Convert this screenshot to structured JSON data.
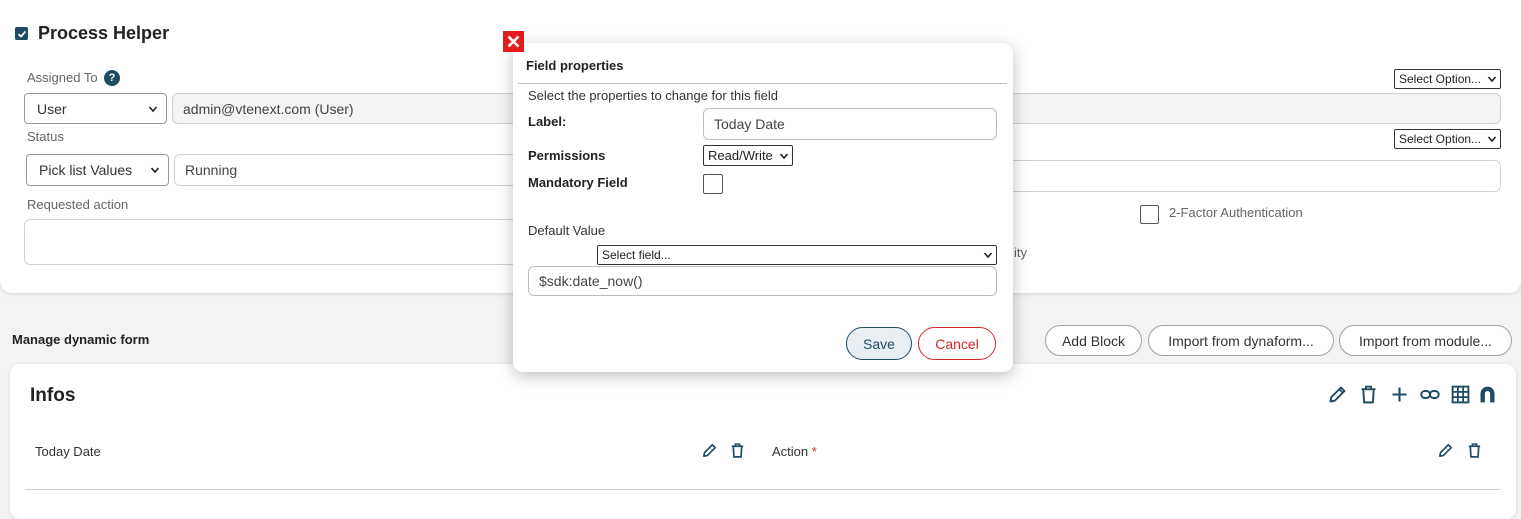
{
  "process_helper": {
    "title": "Process Helper",
    "assigned_to": {
      "label": "Assigned To",
      "help": "?",
      "type_select": "User",
      "value": "admin@vtenext.com (User)"
    },
    "status": {
      "label": "Status",
      "type_select": "Pick list Values",
      "value": "Running"
    },
    "requested_action": {
      "label": "Requested action",
      "value": ""
    },
    "right_select_1": "Select Option...",
    "right_select_2": "Select Option...",
    "partial_text": "ity",
    "two_factor_label": "2-Factor Authentication"
  },
  "dynamic_form": {
    "title": "Manage dynamic form",
    "buttons": {
      "add_block": "Add Block",
      "import_dynaform": "Import from dynaform...",
      "import_module": "Import from module..."
    }
  },
  "infos_block": {
    "title": "Infos",
    "fields": [
      {
        "label": "Today Date",
        "mandatory": ""
      },
      {
        "label": "Action",
        "mandatory": "*"
      }
    ]
  },
  "modal": {
    "title": "Field properties",
    "subtitle": "Select the properties to change for this field",
    "label_caption": "Label:",
    "label_value": "Today Date",
    "permissions_caption": "Permissions",
    "permissions_value": "Read/Write",
    "mandatory_caption": "Mandatory Field",
    "default_caption": "Default Value",
    "select_field": "Select field...",
    "default_value": "$sdk:date_now()",
    "save": "Save",
    "cancel": "Cancel"
  },
  "colors": {
    "accent": "#1f4b63",
    "danger": "#d9262b",
    "close_red": "#e31b1b"
  }
}
